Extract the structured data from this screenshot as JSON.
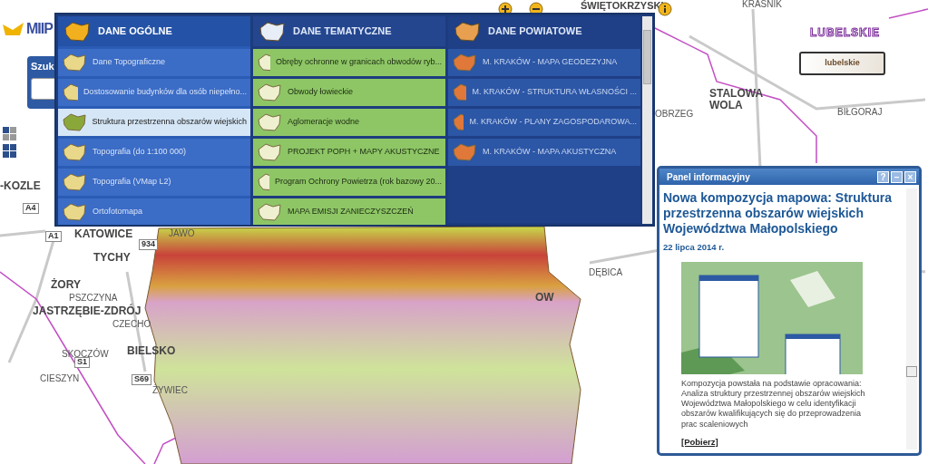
{
  "logo": {
    "text": "MIIP"
  },
  "search_panel": {
    "title": "Szuk"
  },
  "map": {
    "labels": [
      {
        "text": "ŚWIĘTOKRZYSKI",
        "kind": "region"
      },
      {
        "text": "KRAŚNIK",
        "kind": "town"
      },
      {
        "text": "LUBELSKIE",
        "kind": "voivodeship"
      },
      {
        "text": "STALOWA WOLA",
        "kind": "city"
      },
      {
        "text": "BIŁGORAJ",
        "kind": "town"
      },
      {
        "text": "OBRZEG",
        "kind": "town"
      },
      {
        "text": "-KOZLE",
        "kind": "city"
      },
      {
        "text": "A4",
        "kind": "road"
      },
      {
        "text": "A1",
        "kind": "road"
      },
      {
        "text": "KATOWICE",
        "kind": "city"
      },
      {
        "text": "JAWO",
        "kind": "town"
      },
      {
        "text": "TYCHY",
        "kind": "city"
      },
      {
        "text": "934",
        "kind": "road"
      },
      {
        "text": "ŻORY",
        "kind": "city"
      },
      {
        "text": "PSZCZYNA",
        "kind": "town"
      },
      {
        "text": "JASTRZĘBIE-ZDRÓJ",
        "kind": "city"
      },
      {
        "text": "CZECHO",
        "kind": "town"
      },
      {
        "text": "BIELSKO",
        "kind": "city"
      },
      {
        "text": "SKOCZÓW",
        "kind": "town"
      },
      {
        "text": "S1",
        "kind": "road"
      },
      {
        "text": "CIESZYN",
        "kind": "town"
      },
      {
        "text": "S69",
        "kind": "road"
      },
      {
        "text": "ŻYWIEC",
        "kind": "town"
      },
      {
        "text": "DĘBICA",
        "kind": "town"
      },
      {
        "text": "OW",
        "kind": "city"
      }
    ],
    "badge": {
      "text": "lubelskie"
    }
  },
  "menu": {
    "columns": [
      {
        "title": "DANE OGÓLNE",
        "kind": "general",
        "items": [
          {
            "label": "Dane Topograficzne",
            "selected": false
          },
          {
            "label": "Dostosowanie budynków dla osób niepełno...",
            "selected": false
          },
          {
            "label": "Struktura przestrzenna obszarów wiejskich",
            "selected": true
          },
          {
            "label": "Topografia (do 1:100 000)",
            "selected": false
          },
          {
            "label": "Topografia (VMap L2)",
            "selected": false
          },
          {
            "label": "Ortofotomapa",
            "selected": false
          }
        ]
      },
      {
        "title": "DANE TEMATYCZNE",
        "kind": "thematic",
        "items": [
          {
            "label": "Obręby ochronne w granicach obwodów ryb...",
            "selected": false
          },
          {
            "label": "Obwody łowieckie",
            "selected": false
          },
          {
            "label": "Aglomeracje wodne",
            "selected": false
          },
          {
            "label": "PROJEKT POPH + MAPY AKUSTYCZNE",
            "selected": false
          },
          {
            "label": "Program Ochrony Powietrza (rok bazowy 20...",
            "selected": false
          },
          {
            "label": "MAPA EMISJI ZANIECZYSZCZEŃ",
            "selected": false
          }
        ]
      },
      {
        "title": "DANE POWIATOWE",
        "kind": "county",
        "items": [
          {
            "label": "M. KRAKÓW - MAPA GEODEZYJNA",
            "selected": false
          },
          {
            "label": "M. KRAKÓW - STRUKTURA WŁASNOŚCI ...",
            "selected": false
          },
          {
            "label": "M. KRAKÓW - PLANY ZAGOSPODAROWA...",
            "selected": false
          },
          {
            "label": "M. KRAKÓW - MAPA AKUSTYCZNA",
            "selected": false
          }
        ]
      }
    ]
  },
  "info_panel": {
    "title": "Panel informacyjny",
    "buttons": [
      "?",
      "–",
      "×"
    ],
    "headline": "Nowa kompozycja mapowa: Struktura przestrzenna obszarów wiejskich Województwa Małopolskiego",
    "date": "22 lipca 2014 r.",
    "body": "Kompozycja powstała na podstawie opracowania: Analiza struktury przestrzennej obszarów wiejskich Województwa Małopolskiego w celu identyfikacji obszarów kwalifikujących się do przeprowadzenia prac scaleniowych",
    "link": "[Pobierz]"
  }
}
